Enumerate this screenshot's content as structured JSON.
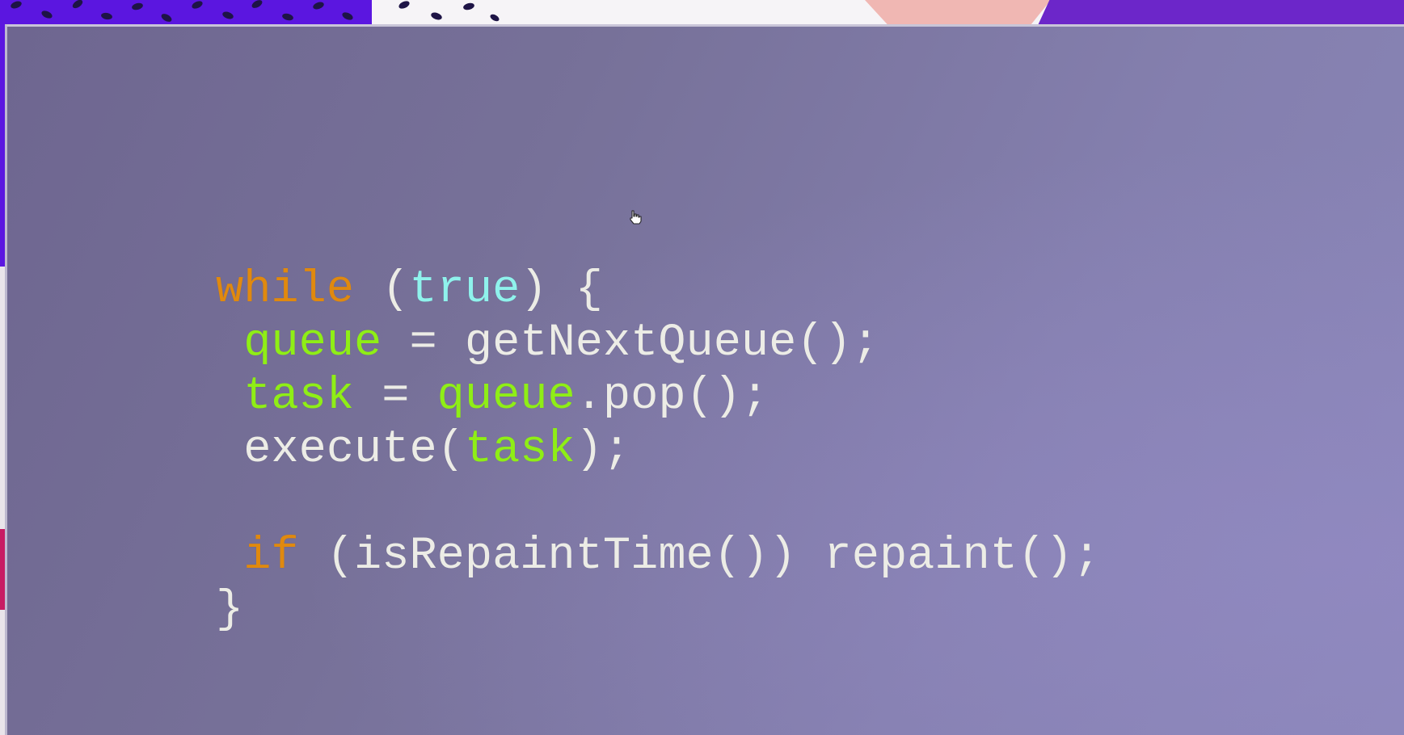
{
  "colors": {
    "slide_background": "#7a74a2",
    "keyword": "#e0890f",
    "literal": "#8ff2ec",
    "variable": "#8fee16",
    "text": "#ecece6"
  },
  "cursor": {
    "icon": "hand-pointer-icon"
  },
  "code": {
    "language": "javascript",
    "lines": [
      [
        {
          "t": "while",
          "k": "kw"
        },
        {
          "t": " (",
          "k": "plain"
        },
        {
          "t": "true",
          "k": "lit"
        },
        {
          "t": ") {",
          "k": "plain"
        }
      ],
      [
        {
          "t": " ",
          "k": "plain"
        },
        {
          "t": "queue",
          "k": "var"
        },
        {
          "t": " = getNextQueue();",
          "k": "plain"
        }
      ],
      [
        {
          "t": " ",
          "k": "plain"
        },
        {
          "t": "task",
          "k": "var"
        },
        {
          "t": " = ",
          "k": "plain"
        },
        {
          "t": "queue",
          "k": "var"
        },
        {
          "t": ".pop();",
          "k": "plain"
        }
      ],
      [
        {
          "t": " execute(",
          "k": "plain"
        },
        {
          "t": "task",
          "k": "var"
        },
        {
          "t": ");",
          "k": "plain"
        }
      ],
      [
        {
          "t": "",
          "k": "plain"
        }
      ],
      [
        {
          "t": " ",
          "k": "plain"
        },
        {
          "t": "if",
          "k": "kw"
        },
        {
          "t": " (isRepaintTime()) repaint();",
          "k": "plain"
        }
      ],
      [
        {
          "t": "}",
          "k": "plain"
        }
      ]
    ]
  }
}
